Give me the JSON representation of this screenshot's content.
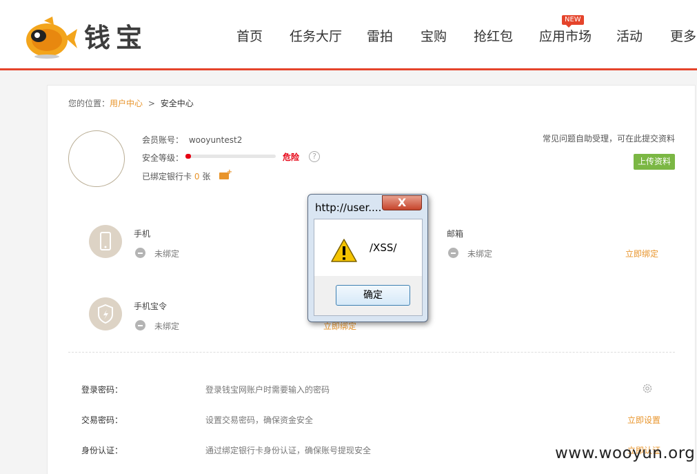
{
  "header": {
    "logo_text": "钱宝",
    "nav": [
      "首页",
      "任务大厅",
      "雷拍",
      "宝购",
      "抢红包",
      "应用市场",
      "活动",
      "更多"
    ],
    "new_badge": "NEW",
    "accent": "#e5442b"
  },
  "breadcrumb": {
    "prefix": "您的位置：",
    "link": "用户中心",
    "sep": ">",
    "current": "安全中心"
  },
  "account": {
    "member_label": "会员账号：",
    "member_value": "wooyuntest2",
    "level_label": "安全等级：",
    "level_fraction": 0.06,
    "level_text": "危险",
    "help": "?",
    "bank_prefix": "已绑定银行卡",
    "bank_count": "0",
    "bank_suffix": "张"
  },
  "faq": {
    "text": "常见问题自助受理，可在此提交资料",
    "button": "上传资料"
  },
  "bindings": {
    "phone": {
      "title": "手机",
      "status": "未绑定"
    },
    "email": {
      "title": "邮箱",
      "status": "未绑定",
      "action": "立即绑定"
    },
    "token": {
      "title": "手机宝令",
      "status": "未绑定",
      "action": "立即绑定"
    }
  },
  "settings": [
    {
      "label": "登录密码：",
      "desc": "登录钱宝网账户时需要输入的密码",
      "action": ""
    },
    {
      "label": "交易密码：",
      "desc": "设置交易密码，确保资金安全",
      "action": "立即设置"
    },
    {
      "label": "身份认证：",
      "desc": "通过绑定银行卡身份认证，确保账号提现安全",
      "action": "立即认证"
    }
  ],
  "dialog": {
    "title": "http://user....",
    "close": "X",
    "message": "/XSS/",
    "ok": "确定"
  },
  "watermark": "www.wooyun.org"
}
